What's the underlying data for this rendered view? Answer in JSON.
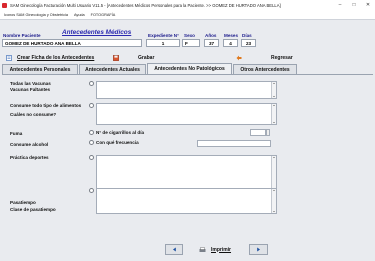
{
  "window": {
    "title": "SAM Ginecología Facturación Multi Usuario V11.5 - [Antecedentes Médicos Personales para la Paciente. >> GOMEZ DE HURTADO ANA BELLA]"
  },
  "menu": [
    "Iconos SAM Ginecología y Obstetricia",
    "Ayuda",
    "FOTOGRAFÍA"
  ],
  "form": {
    "title": "Antecedentes Médicos",
    "patient_label": "Nombre Paciente",
    "patient_name": "GOMEZ DE HURTADO ANA BELLA",
    "record_label": "Expediente N°",
    "record_value": "1",
    "sex_label": "Sexo",
    "sex_value": "F",
    "years_label": "Años",
    "years_value": "37",
    "months_label": "Meses",
    "months_value": "4",
    "days_label": "Días",
    "days_value": "23"
  },
  "actions": {
    "create": "Crear Ficha de los Antecedentes",
    "save": "Grabar",
    "back": "Regresar"
  },
  "tabs": [
    "Antecedentes Personales",
    "Antecedentes Actuales",
    "Antecedentes No Patológicos",
    "Otros Antercedentes"
  ],
  "rows": {
    "vaccines": "Todas las  Vacunas",
    "vaccines_missing": "Vacunas Faltantes",
    "food": "Consume todo tipo de alimentos",
    "food_which": "Cuáles no consume?",
    "smoke": "Fuma",
    "cigarettes": "N° de cigarrillos al día",
    "alcohol": "Consume alcohol",
    "frequency": "Con qué frecuencia",
    "sports": "Práctica deportes",
    "hobby": "Pasatiempo",
    "hobby_type": "Clase de pasatiempo"
  },
  "footer": {
    "print": "Imprimir"
  },
  "colors": {
    "label_blue": "#1c1b8c",
    "title_blue": "#2b2ab0",
    "panel": "#e9ebef"
  },
  "icons": [
    "app-icon",
    "create-record-icon",
    "save-icon",
    "back-icon",
    "prev-icon",
    "print-icon",
    "next-icon"
  ]
}
